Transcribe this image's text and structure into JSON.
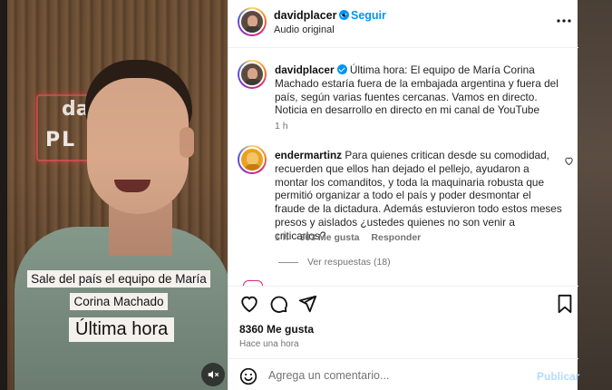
{
  "video": {
    "neon_line1": "da",
    "neon_line2": "PL",
    "caption_top": "Sale del país el equipo de María Corina Machado",
    "caption_bottom": "Última hora",
    "mute_icon": "speaker-muted-icon"
  },
  "post": {
    "username": "davidplacer",
    "follow_label": "Seguir",
    "separator": "•",
    "audio_label": "Audio original",
    "more_icon": "more-horizontal-icon",
    "caption_username": "davidplacer",
    "caption_text": "Última hora: El equipo de María Corina Machado estaría fuera de la embajada argentina y fuera del país, según varias fuentes cercanas. Vamos en directo. Noticia en desarrollo en directo en mi canal de YouTube",
    "caption_time": "1 h"
  },
  "comment": {
    "username": "endermartinz",
    "text": "Para quienes critican desde su comodidad, recuerden que ellos han dejado el pellejo, ayudaron a montar los comanditos, y toda la maquinaria robusta que permitió organizar a todo el país y poder desmontar el fraude de la dictadura. Además estuvieron todo estos meses presos y aislados ¿ustedes quienes no son venir a criticarlos?",
    "time": "1 h",
    "likes": "363 Me gusta",
    "reply_label": "Responder",
    "view_replies": "Ver respuestas (18)"
  },
  "actions": {
    "likes": "8360 Me gusta",
    "time_ago": "Hace una hora"
  },
  "composer": {
    "placeholder": "Agrega un comentario...",
    "publish_label": "Publicar"
  }
}
